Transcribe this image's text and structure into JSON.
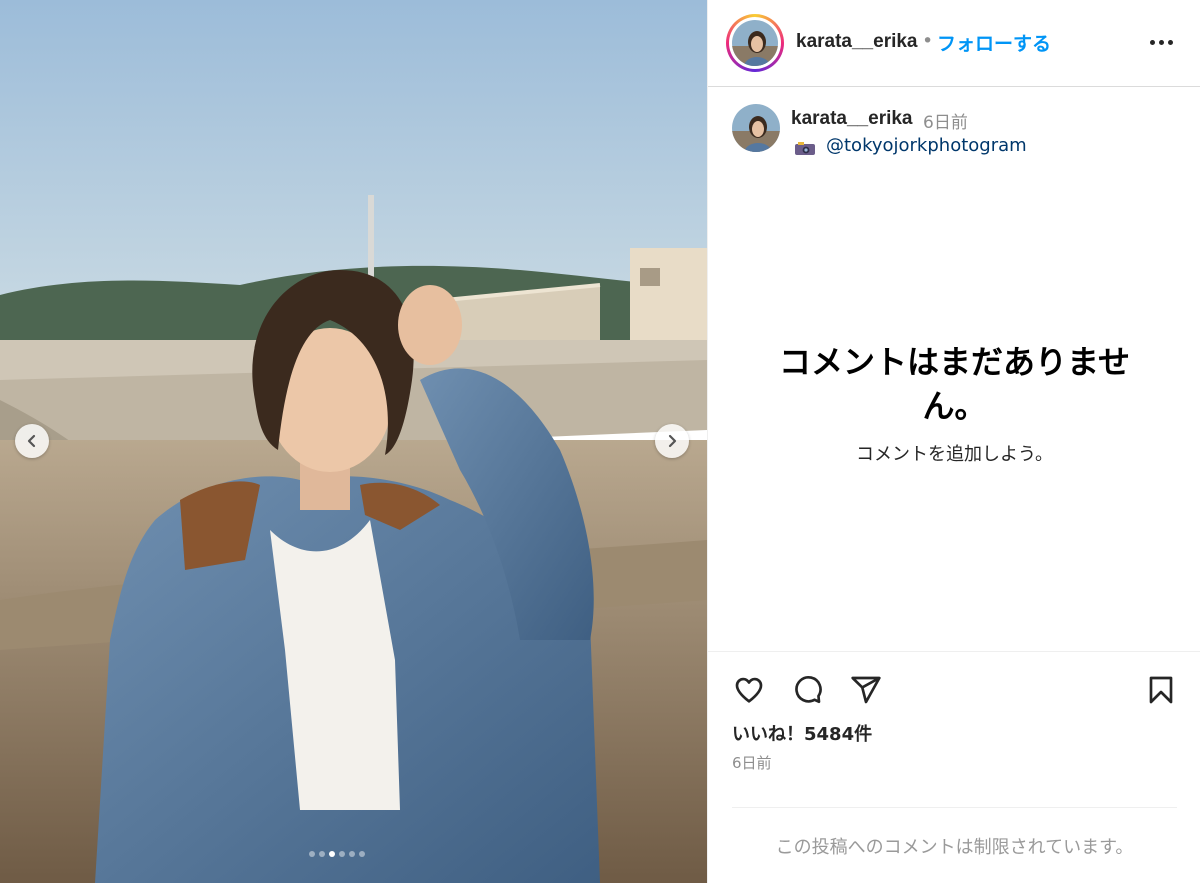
{
  "header": {
    "username": "karata__erika",
    "separator": "•",
    "follow_label": "フォローする",
    "more_icon": "more-horizontal-icon"
  },
  "caption": {
    "username": "karata__erika",
    "time": "6日前",
    "camera_icon": "camera-emoji",
    "mention": "@tokyojorkphotogram"
  },
  "comments": {
    "empty_title": "コメントはまだありません。",
    "empty_sub": "コメントを追加しよう。"
  },
  "actions": {
    "like_icon": "heart-icon",
    "comment_icon": "comment-icon",
    "share_icon": "share-icon",
    "save_icon": "bookmark-icon"
  },
  "stats": {
    "likes": "いいね！5484件",
    "ago": "6日前"
  },
  "footer": {
    "restricted": "この投稿へのコメントは制限されています。"
  },
  "carousel": {
    "slide_count": 6,
    "active_index": 2
  },
  "colors": {
    "accent": "#0095f6",
    "mention": "#00376b",
    "muted": "#8e8e8e"
  }
}
